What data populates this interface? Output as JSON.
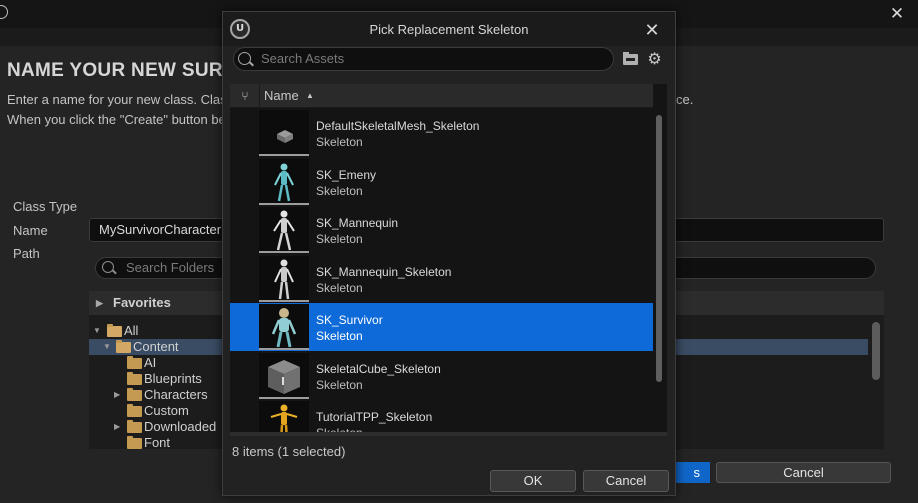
{
  "background": {
    "heading": "NAME YOUR NEW SURVIVO",
    "desc_line1": "Enter a name for your new class. Clas",
    "desc_line1_tail": "ce.",
    "desc_line2": "When you click the \"Create\" button be",
    "class_type_label": "Class Type",
    "name_label": "Name",
    "path_label": "Path",
    "name_value": "MySurvivorCharacter",
    "folder_search_placeholder": "Search Folders",
    "favorites_label": "Favorites",
    "tree": [
      {
        "label": "All"
      },
      {
        "label": "Content"
      },
      {
        "label": "AI"
      },
      {
        "label": "Blueprints"
      },
      {
        "label": "Characters"
      },
      {
        "label": "Custom"
      },
      {
        "label": "Downloaded"
      },
      {
        "label": "Font"
      }
    ],
    "create_label": "s",
    "cancel_label": "Cancel",
    "close_icon": "close-icon",
    "accent_color": "#0d6ad8"
  },
  "modal": {
    "title": "Pick Replacement Skeleton",
    "search_placeholder": "Search Assets",
    "column_name": "Name",
    "sort_direction": "ascending",
    "assets": [
      {
        "name": "DefaultSkeletalMesh_Skeleton",
        "type": "Skeleton",
        "thumbnail": "gray-cube"
      },
      {
        "name": "SK_Emeny",
        "type": "Skeleton",
        "thumbnail": "cyan-figure"
      },
      {
        "name": "SK_Mannequin",
        "type": "Skeleton",
        "thumbnail": "white-figure"
      },
      {
        "name": "SK_Mannequin_Skeleton",
        "type": "Skeleton",
        "thumbnail": "white-figure"
      },
      {
        "name": "SK_Survivor",
        "type": "Skeleton",
        "thumbnail": "cyan-figure",
        "selected": true
      },
      {
        "name": "SkeletalCube_Skeleton",
        "type": "Skeleton",
        "thumbnail": "gray-cube-large"
      },
      {
        "name": "TutorialTPP_Skeleton",
        "type": "Skeleton",
        "thumbnail": "yellow-figure"
      }
    ],
    "status": "8 items (1 selected)",
    "ok_label": "OK",
    "cancel_label": "Cancel"
  }
}
